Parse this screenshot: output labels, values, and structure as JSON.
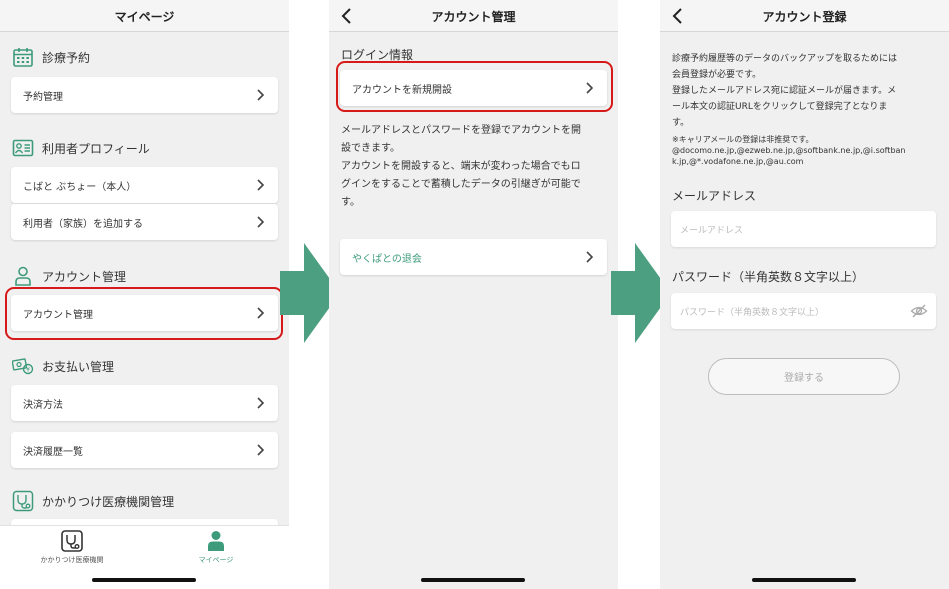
{
  "colors": {
    "accent_green": "#3d9b7c",
    "arrow_green": "#4d9f81",
    "highlight_red": "#d61a1a",
    "withdraw_text": "#3d9b7c"
  },
  "screen1": {
    "title": "マイページ",
    "sections": {
      "appointment": {
        "label": "診療予約",
        "icon": "calendar-icon"
      },
      "profile": {
        "label": "利用者プロフィール",
        "icon": "id-card-icon"
      },
      "account": {
        "label": "アカウント管理",
        "icon": "person-icon"
      },
      "payment": {
        "label": "お支払い管理",
        "icon": "money-icon"
      },
      "clinic": {
        "label": "かかりつけ医療機関管理",
        "icon": "stethoscope-icon"
      }
    },
    "items": {
      "appointment_manage": "予約管理",
      "user_self": "こばと ぶちょー（本人）",
      "add_family": "利用者（家族）を追加する",
      "account_manage": "アカウント管理",
      "payment_method": "決済方法",
      "payment_history": "決済履歴一覧"
    },
    "tabs": {
      "clinic": "かかりつけ医療機関",
      "mypage": "マイページ"
    }
  },
  "screen2": {
    "title": "アカウント管理",
    "login_heading": "ログイン情報",
    "new_account": "アカウントを新規開設",
    "description": [
      "メールアドレスとパスワードを登録でアカウントを開",
      "設できます。",
      "アカウントを開設すると、端末が変わった場合でもロ",
      "グインをすることで蓄積したデータの引継ぎが可能で",
      "す。"
    ],
    "withdraw": "やくぱとの退会"
  },
  "screen3": {
    "title": "アカウント登録",
    "intro": [
      "診療予約履歴等のデータのバックアップを取るためには",
      "会員登録が必要です。",
      "登録したメールアドレス宛に認証メールが届きます。メ",
      "ール本文の認証URLをクリックして登録完了となりま",
      "す。"
    ],
    "note": [
      "※キャリアメールの登録は非推奨です。",
      "@docomo.ne.jp,@ezweb.ne.jp,@softbank.ne.jp,@i.softban",
      "k.jp,@*.vodafone.ne.jp,@au.com"
    ],
    "email_label": "メールアドレス",
    "email_placeholder": "メールアドレス",
    "password_label": "パスワード（半角英数８文字以上）",
    "password_placeholder": "パスワード（半角英数８文字以上）",
    "register_button": "登録する"
  }
}
